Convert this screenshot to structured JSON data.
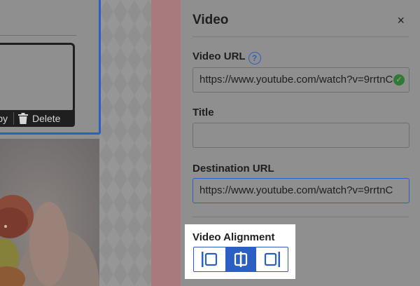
{
  "canvas": {
    "card_actions": {
      "copy_label": "Copy",
      "delete_label": "Delete"
    }
  },
  "panel": {
    "title": "Video",
    "close_label": "×",
    "video_url": {
      "label": "Video URL",
      "help_label": "?",
      "value": "https://www.youtube.com/watch?v=9rrtnC"
    },
    "title_field": {
      "label": "Title",
      "value": ""
    },
    "destination_url": {
      "label": "Destination URL",
      "value": "https://www.youtube.com/watch?v=9rrtnC"
    },
    "alignment": {
      "label": "Video Alignment",
      "options": [
        "align-left-icon",
        "align-center-icon",
        "align-right-icon"
      ],
      "selected": "center"
    }
  },
  "colors": {
    "accent": "#2b5fc4",
    "valid": "#2f7a35",
    "overlay": "#8f8f8f"
  }
}
